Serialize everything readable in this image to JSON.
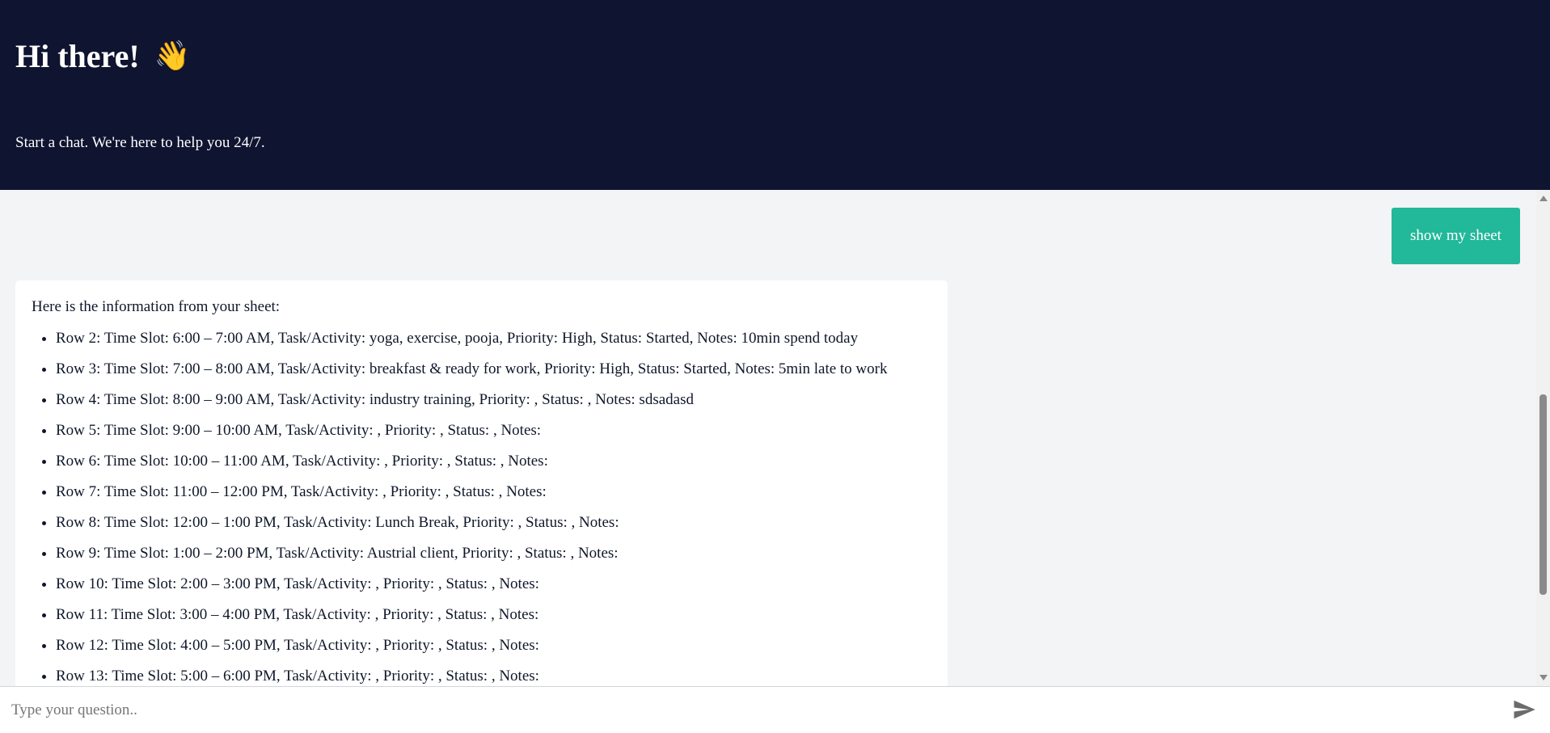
{
  "header": {
    "title": "Hi there!",
    "wave_emoji": "👋",
    "subtitle": "Start a chat. We're here to help you 24/7."
  },
  "messages": {
    "user_message": "show my sheet",
    "bot_intro": "Here is the information from your sheet:",
    "rows": [
      "Row 2: Time Slot: 6:00 – 7:00 AM, Task/Activity: yoga, exercise, pooja, Priority: High, Status: Started, Notes: 10min spend today",
      "Row 3: Time Slot: 7:00 – 8:00 AM, Task/Activity: breakfast & ready for work, Priority: High, Status: Started, Notes: 5min late to work",
      "Row 4: Time Slot: 8:00 – 9:00 AM, Task/Activity: industry training, Priority: , Status: , Notes: sdsadasd",
      "Row 5: Time Slot: 9:00 – 10:00 AM, Task/Activity: , Priority: , Status: , Notes:",
      "Row 6: Time Slot: 10:00 – 11:00 AM, Task/Activity: , Priority: , Status: , Notes:",
      "Row 7: Time Slot: 11:00 – 12:00 PM, Task/Activity: , Priority: , Status: , Notes:",
      "Row 8: Time Slot: 12:00 – 1:00 PM, Task/Activity: Lunch Break, Priority: , Status: , Notes:",
      "Row 9: Time Slot: 1:00 – 2:00 PM, Task/Activity: Austrial client, Priority: , Status: , Notes:",
      "Row 10: Time Slot: 2:00 – 3:00 PM, Task/Activity: , Priority: , Status: , Notes:",
      "Row 11: Time Slot: 3:00 – 4:00 PM, Task/Activity: , Priority: , Status: , Notes:",
      "Row 12: Time Slot: 4:00 – 5:00 PM, Task/Activity: , Priority: , Status: , Notes:",
      "Row 13: Time Slot: 5:00 – 6:00 PM, Task/Activity: , Priority: , Status: , Notes:"
    ]
  },
  "input": {
    "placeholder": "Type your question.."
  },
  "icons": {
    "send": "send-icon"
  },
  "colors": {
    "header_bg": "#0f1430",
    "user_bubble": "#22b89a",
    "chat_bg": "#f3f4f6"
  }
}
